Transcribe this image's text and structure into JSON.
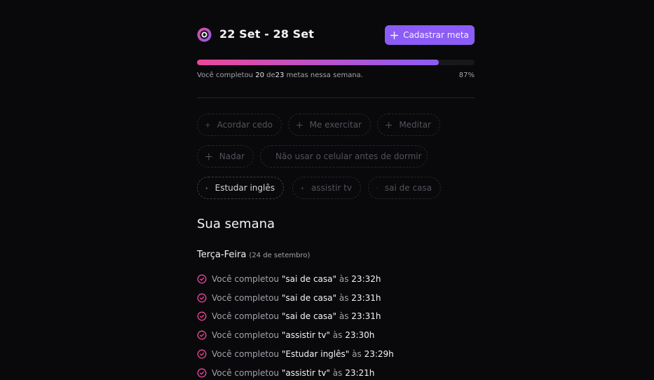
{
  "header": {
    "week_range": "22 Set - 28 Set",
    "cta_label": "Cadastrar meta",
    "logo_icon": "in-orbit-logo-icon",
    "accent_color": "#8b5cf6",
    "gradient_start": "#ec4899",
    "gradient_end": "#8b5cf6"
  },
  "progress": {
    "prefix": "Você completou",
    "completed": "20",
    "of_word": "de",
    "total": "23",
    "suffix": "metas nessa semana.",
    "percent_label": "87%",
    "percent_value": 87
  },
  "pending_goals": [
    {
      "label": "Acordar cedo",
      "active": false
    },
    {
      "label": "Me exercitar",
      "active": false
    },
    {
      "label": "Meditar",
      "active": false
    },
    {
      "label": "Nadar",
      "active": false
    },
    {
      "label": "Não usar o celular antes de dormir",
      "active": false
    },
    {
      "label": "Estudar inglês",
      "active": true
    },
    {
      "label": "assistir tv",
      "active": false
    },
    {
      "label": "sai de casa",
      "active": false
    }
  ],
  "week": {
    "title": "Sua semana",
    "days": [
      {
        "weekday": "Terça-Feira",
        "date": "(24 de setembro)",
        "activities": [
          {
            "prefix": "Você completou",
            "goal": "\"sai de casa\"",
            "at": "às",
            "time": "23:32h"
          },
          {
            "prefix": "Você completou",
            "goal": "\"sai de casa\"",
            "at": "às",
            "time": "23:31h"
          },
          {
            "prefix": "Você completou",
            "goal": "\"sai de casa\"",
            "at": "às",
            "time": "23:31h"
          },
          {
            "prefix": "Você completou",
            "goal": "\"assistir tv\"",
            "at": "às",
            "time": "23:30h"
          },
          {
            "prefix": "Você completou",
            "goal": "\"Estudar inglês\"",
            "at": "às",
            "time": "23:29h"
          },
          {
            "prefix": "Você completou",
            "goal": "\"assistir tv\"",
            "at": "às",
            "time": "23:21h"
          }
        ]
      }
    ]
  }
}
